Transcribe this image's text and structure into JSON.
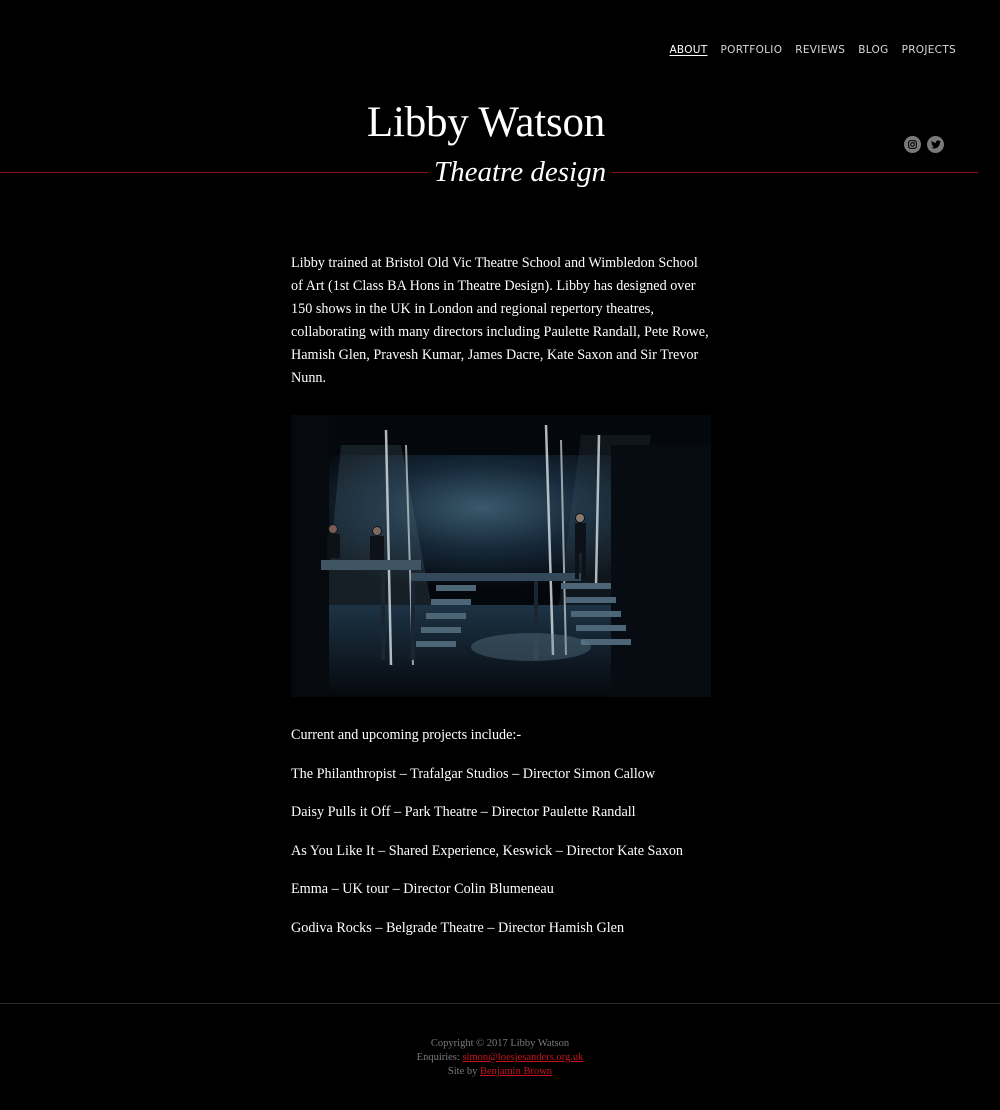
{
  "nav": {
    "items": [
      {
        "label": "ABOUT",
        "active": true
      },
      {
        "label": "PORTFOLIO",
        "active": false
      },
      {
        "label": "REVIEWS",
        "active": false
      },
      {
        "label": "BLOG",
        "active": false
      },
      {
        "label": "PROJECTS",
        "active": false
      }
    ]
  },
  "header": {
    "title": "Libby Watson",
    "tagline": "Theatre design",
    "social": [
      "instagram-icon",
      "twitter-icon"
    ]
  },
  "main": {
    "intro": "Libby trained at Bristol Old Vic Theatre School and Wimbledon School of Art (1st Class BA Hons in Theatre Design). Libby has designed over 150 shows in the UK in London and regional repertory theatres, collaborating with many directors including Paulette Randall, Pete Rowe, Hamish Glen, Pravesh Kumar, James Dacre, Kate Saxon and Sir Trevor Nunn.",
    "projects_heading": "Current and upcoming projects include:-",
    "projects": [
      "The Philanthropist – Trafalgar Studios – Director Simon Callow",
      "Daisy Pulls it Off – Park Theatre – Director Paulette Randall",
      "As You Like It – Shared Experience, Keswick – Director Kate Saxon",
      "Emma – UK tour – Director Colin Blumeneau",
      "Godiva Rocks – Belgrade Theatre – Director Hamish Glen"
    ]
  },
  "footer": {
    "copyright": "Copyright © 2017 Libby Watson",
    "enquiries_label": "Enquiries:",
    "enquiries_email": "simon@loesjesanders.org.uk",
    "site_by_label": "Site by",
    "site_by_name": "Benjamin Brown"
  },
  "colors": {
    "background": "#000000",
    "rule": "#8a1418",
    "link_red": "#c8141d"
  }
}
